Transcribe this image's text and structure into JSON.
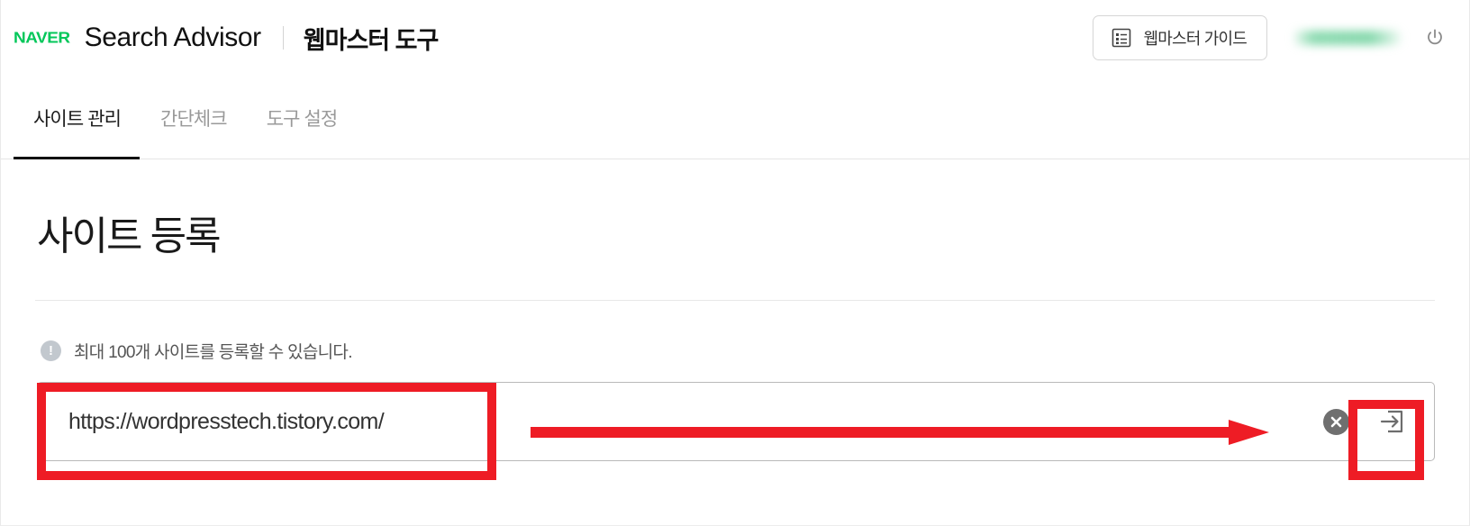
{
  "header": {
    "logo_text": "NAVER",
    "brand_name": "Search Advisor",
    "brand_sub": "웹마스터 도구",
    "guide_button_label": "웹마스터 가이드",
    "guide_icon": "list-document-icon",
    "user_name": "",
    "logout_icon": "power-icon"
  },
  "tabs": [
    {
      "label": "사이트 관리",
      "active": true
    },
    {
      "label": "간단체크",
      "active": false
    },
    {
      "label": "도구 설정",
      "active": false
    }
  ],
  "main": {
    "page_title": "사이트 등록",
    "notice_icon": "!",
    "notice_text": "최대 100개 사이트를 등록할 수 있습니다.",
    "url_input": {
      "value": "https://wordpresstech.tistory.com/",
      "placeholder": "https://",
      "clear_icon": "close-circle-icon",
      "submit_icon": "enter-arrow-icon"
    }
  },
  "annotations": {
    "color": "#ee1c25",
    "highlight_input": "url-input-field",
    "highlight_submit": "submit-button",
    "arrow": "points-right-to-submit-button"
  }
}
